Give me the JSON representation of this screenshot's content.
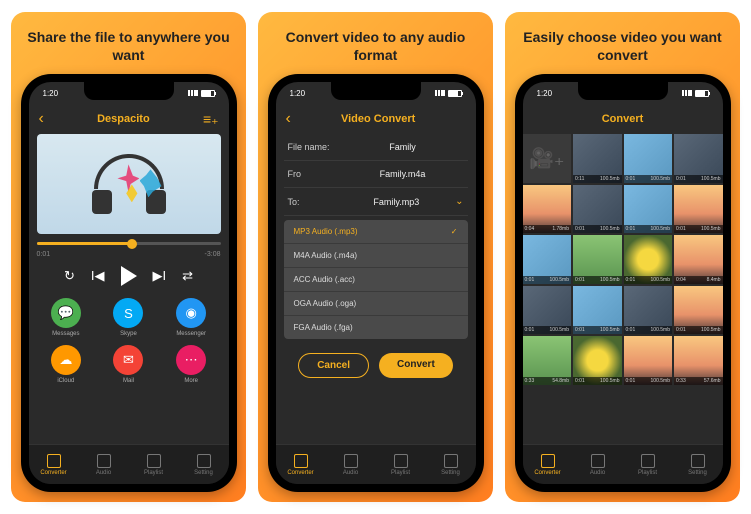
{
  "panels": [
    {
      "tagline": "Share the file to anywhere you want"
    },
    {
      "tagline": "Convert video to any audio format"
    },
    {
      "tagline": "Easily choose video you want convert"
    }
  ],
  "statusbar": {
    "time": "1:20"
  },
  "screen1": {
    "title": "Despacito",
    "time_current": "0:01",
    "time_total": "-3:08",
    "share": [
      {
        "label": "Messages",
        "color": "c-green",
        "icon": "💬"
      },
      {
        "label": "Skype",
        "color": "c-blue",
        "icon": "S"
      },
      {
        "label": "Messenger",
        "color": "c-blue2",
        "icon": "◉"
      },
      {
        "label": "iCloud",
        "color": "c-orange",
        "icon": "☁"
      },
      {
        "label": "Mail",
        "color": "c-red",
        "icon": "✉"
      },
      {
        "label": "More",
        "color": "c-pink",
        "icon": "⋯"
      }
    ]
  },
  "screen2": {
    "title": "Video Convert",
    "filename_label": "File name:",
    "filename_value": "Family",
    "from_label": "Fro",
    "from_value": "Family.m4a",
    "to_label": "To:",
    "to_value": "Family.mp3",
    "options": [
      {
        "label": "MP3 Audio (.mp3)",
        "selected": true
      },
      {
        "label": "M4A Audio (.m4a)"
      },
      {
        "label": "ACC Audio (.acc)"
      },
      {
        "label": "OGA Audio (.oga)"
      },
      {
        "label": "FGA Audio (.fga)"
      }
    ],
    "cancel": "Cancel",
    "convert": "Convert"
  },
  "screen3": {
    "title": "Convert",
    "thumbs": [
      {
        "add": true
      },
      {
        "t": "0:11",
        "s": "100.5mb",
        "cls": "dark"
      },
      {
        "t": "0:01",
        "s": "100.5mb",
        "cls": ""
      },
      {
        "t": "0:01",
        "s": "100.5mb",
        "cls": "dark"
      },
      {
        "t": "0:04",
        "s": "1.78mb",
        "cls": "sunset"
      },
      {
        "t": "0:01",
        "s": "100.5mb",
        "cls": "dark"
      },
      {
        "t": "0:01",
        "s": "100.5mb",
        "cls": ""
      },
      {
        "t": "0:01",
        "s": "100.5mb",
        "cls": "sunset"
      },
      {
        "t": "0:01",
        "s": "100.5mb",
        "cls": ""
      },
      {
        "t": "0:01",
        "s": "100.5mb",
        "cls": "grass"
      },
      {
        "t": "0:01",
        "s": "100.5mb",
        "cls": "flower"
      },
      {
        "t": "0:04",
        "s": "8.4mb",
        "cls": "sunset"
      },
      {
        "t": "0:01",
        "s": "100.5mb",
        "cls": "dark"
      },
      {
        "t": "0:01",
        "s": "100.5mb",
        "cls": ""
      },
      {
        "t": "0:01",
        "s": "100.5mb",
        "cls": "dark"
      },
      {
        "t": "0:01",
        "s": "100.5mb",
        "cls": "sunset"
      },
      {
        "t": "0:33",
        "s": "54.8mb",
        "cls": "grass"
      },
      {
        "t": "0:01",
        "s": "100.5mb",
        "cls": "flower"
      },
      {
        "t": "0:01",
        "s": "100.5mb",
        "cls": "sunset"
      },
      {
        "t": "0:33",
        "s": "57.6mb",
        "cls": "sunset"
      }
    ]
  },
  "tabs": [
    {
      "label": "Converter",
      "active": true
    },
    {
      "label": "Audio"
    },
    {
      "label": "Playlist"
    },
    {
      "label": "Setting"
    }
  ]
}
